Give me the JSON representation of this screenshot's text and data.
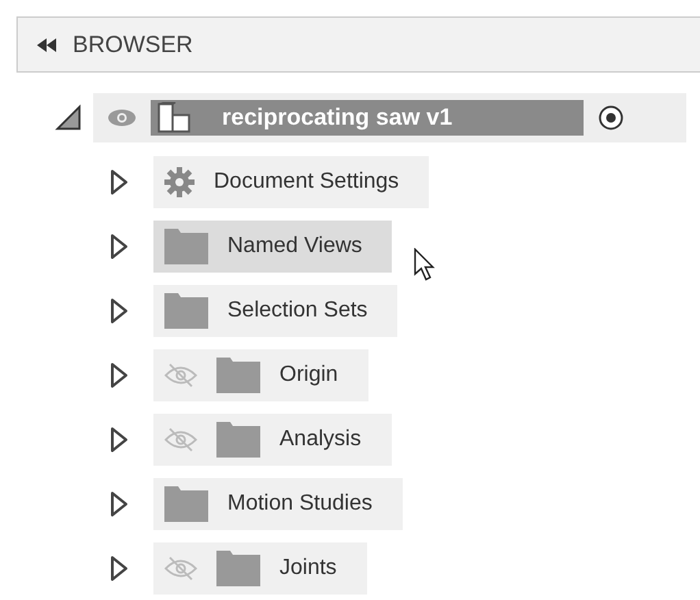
{
  "panel": {
    "title": "BROWSER"
  },
  "root": {
    "label": "reciprocating saw v1",
    "expanded": true,
    "visible": true,
    "active": true
  },
  "items": [
    {
      "label": "Document Settings",
      "kind": "settings",
      "hidden": false,
      "highlighted": false
    },
    {
      "label": "Named Views",
      "kind": "folder",
      "hidden": false,
      "highlighted": true
    },
    {
      "label": "Selection Sets",
      "kind": "folder",
      "hidden": false,
      "highlighted": false
    },
    {
      "label": "Origin",
      "kind": "folder",
      "hidden": true,
      "highlighted": false
    },
    {
      "label": "Analysis",
      "kind": "folder",
      "hidden": true,
      "highlighted": false
    },
    {
      "label": "Motion Studies",
      "kind": "folder",
      "hidden": false,
      "highlighted": false
    },
    {
      "label": "Joints",
      "kind": "folder",
      "hidden": true,
      "highlighted": false
    }
  ]
}
